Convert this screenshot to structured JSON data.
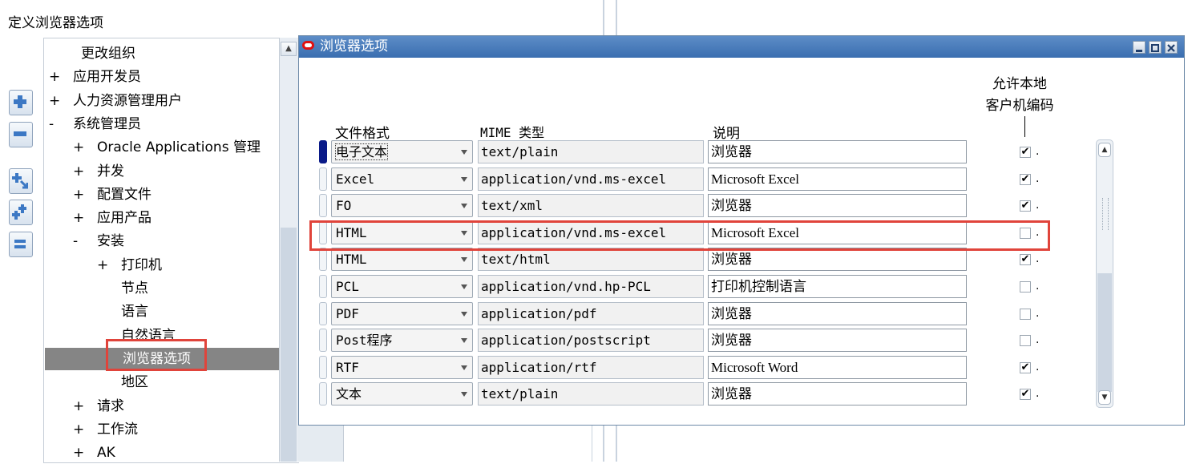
{
  "page": {
    "title": "定义浏览器选项"
  },
  "tree": {
    "nodes": [
      {
        "toggle": "",
        "label": "更改组织"
      },
      {
        "toggle": "+",
        "label": "应用开发员"
      },
      {
        "toggle": "+",
        "label": "人力资源管理用户"
      },
      {
        "toggle": "-",
        "label": "系统管理员"
      },
      {
        "toggle": "+",
        "label": "Oracle Applications 管理"
      },
      {
        "toggle": "+",
        "label": "并发"
      },
      {
        "toggle": "+",
        "label": "配置文件"
      },
      {
        "toggle": "+",
        "label": "应用产品"
      },
      {
        "toggle": "-",
        "label": "安装"
      },
      {
        "toggle": "+",
        "label": "打印机"
      },
      {
        "toggle": "",
        "label": "节点"
      },
      {
        "toggle": "",
        "label": "语言"
      },
      {
        "toggle": "",
        "label": "自然语言"
      },
      {
        "toggle": "",
        "label": "浏览器选项",
        "selected": true
      },
      {
        "toggle": "",
        "label": "地区"
      },
      {
        "toggle": "+",
        "label": "请求"
      },
      {
        "toggle": "+",
        "label": "工作流"
      },
      {
        "toggle": "+",
        "label": "AK"
      }
    ]
  },
  "side_buttons": [
    "expand-icon",
    "collapse-icon",
    "expand-branch-icon",
    "expand-all-icon",
    "collapse-all-icon"
  ],
  "modal": {
    "title": "浏览器选项",
    "columns": {
      "format": "文件格式",
      "mime": "MIME 类型",
      "description": "说明",
      "allow_local": "允许本地",
      "allow_local_2": "客户机编码"
    },
    "rows": [
      {
        "format": "电子文本",
        "mime": "text/plain",
        "description": "浏览器",
        "allow_local": true,
        "current": true
      },
      {
        "format": "Excel",
        "mime": "application/vnd.ms-excel",
        "description": "Microsoft Excel",
        "allow_local": true
      },
      {
        "format": "FO",
        "mime": "text/xml",
        "description": "浏览器",
        "allow_local": true
      },
      {
        "format": "HTML",
        "mime": "application/vnd.ms-excel",
        "description": "Microsoft Excel",
        "allow_local": false,
        "highlighted": true
      },
      {
        "format": "HTML",
        "mime": "text/html",
        "description": "浏览器",
        "allow_local": true
      },
      {
        "format": "PCL",
        "mime": "application/vnd.hp-PCL",
        "description": "打印机控制语言",
        "allow_local": false
      },
      {
        "format": "PDF",
        "mime": "application/pdf",
        "description": "浏览器",
        "allow_local": false
      },
      {
        "format": "Post程序",
        "mime": "application/postscript",
        "description": "浏览器",
        "allow_local": false
      },
      {
        "format": "RTF",
        "mime": "application/rtf",
        "description": "Microsoft Word",
        "allow_local": true
      },
      {
        "format": "文本",
        "mime": "text/plain",
        "description": "浏览器",
        "allow_local": true
      }
    ],
    "checked_glyph": "✔",
    "dot": "."
  },
  "colors": {
    "titlebar": "#3a6eb0",
    "selected_node": "#858585",
    "highlight": "#e0443b",
    "current_row": "#0a1a88"
  }
}
